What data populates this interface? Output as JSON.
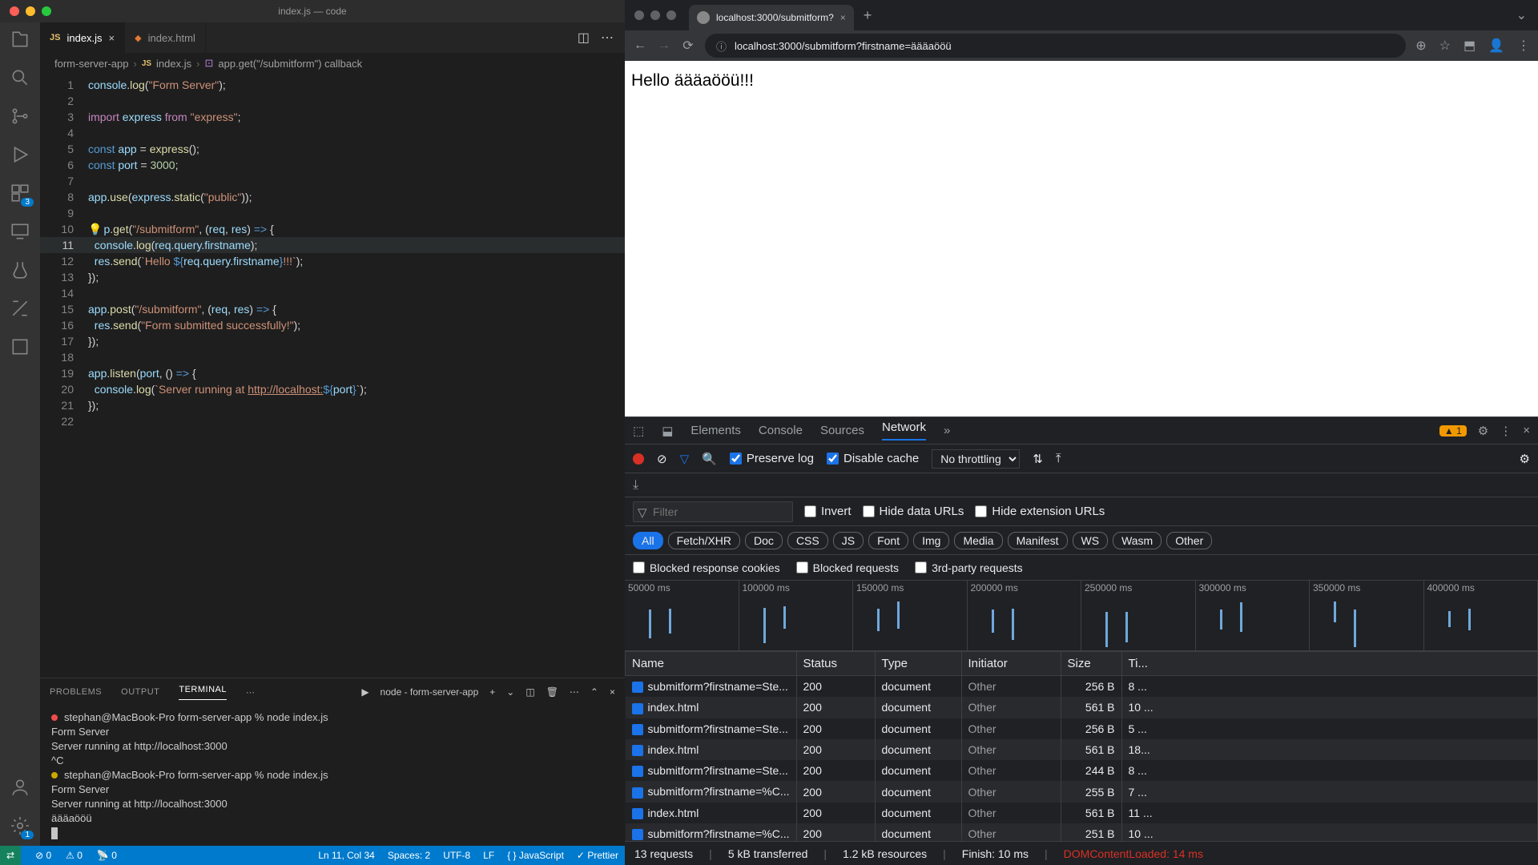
{
  "vscode": {
    "window_title": "index.js — code",
    "tabs": [
      {
        "icon": "JS",
        "label": "index.js",
        "active": true,
        "close": "×"
      },
      {
        "icon": "<>",
        "label": "index.html",
        "active": false
      }
    ],
    "breadcrumb": {
      "root": "form-server-app",
      "file": "index.js",
      "symbol": "app.get(\"/submitform\") callback"
    },
    "code_lines": [
      {
        "n": 1,
        "html": "<span class='var'>console</span>.<span class='fn'>log</span>(<span class='str'>\"Form Server\"</span>);"
      },
      {
        "n": 2,
        "html": ""
      },
      {
        "n": 3,
        "html": "<span class='kw'>import</span> <span class='var'>express</span> <span class='kw'>from</span> <span class='str'>\"express\"</span>;"
      },
      {
        "n": 4,
        "html": ""
      },
      {
        "n": 5,
        "html": "<span class='kw2'>const</span> <span class='var'>app</span> = <span class='fn'>express</span>();"
      },
      {
        "n": 6,
        "html": "<span class='kw2'>const</span> <span class='var'>port</span> = <span class='num'>3000</span>;"
      },
      {
        "n": 7,
        "html": ""
      },
      {
        "n": 8,
        "html": "<span class='var'>app</span>.<span class='fn'>use</span>(<span class='var'>express</span>.<span class='fn'>static</span>(<span class='str'>\"public\"</span>));"
      },
      {
        "n": 9,
        "html": ""
      },
      {
        "n": 10,
        "html": "<span class='bulb'>💡</span><span class='var'>p</span>.<span class='fn'>get</span>(<span class='str'>\"/submitform\"</span>, (<span class='var'>req</span>, <span class='var'>res</span>) <span class='kw2'>=&gt;</span> {"
      },
      {
        "n": 11,
        "html": "  <span class='var'>console</span>.<span class='fn'>log</span>(<span class='var'>req</span>.<span class='var'>query</span>.<span class='var'>firstname</span>);",
        "current": true
      },
      {
        "n": 12,
        "html": "  <span class='var'>res</span>.<span class='fn'>send</span>(<span class='str'>`Hello </span><span class='kw2'>${</span><span class='var'>req</span>.<span class='var'>query</span>.<span class='var'>firstname</span><span class='kw2'>}</span><span class='str'>!!!`</span>);"
      },
      {
        "n": 13,
        "html": "});"
      },
      {
        "n": 14,
        "html": ""
      },
      {
        "n": 15,
        "html": "<span class='var'>app</span>.<span class='fn'>post</span>(<span class='str'>\"/submitform\"</span>, (<span class='var'>req</span>, <span class='var'>res</span>) <span class='kw2'>=&gt;</span> {"
      },
      {
        "n": 16,
        "html": "  <span class='var'>res</span>.<span class='fn'>send</span>(<span class='str'>\"Form submitted successfully!\"</span>);"
      },
      {
        "n": 17,
        "html": "});"
      },
      {
        "n": 18,
        "html": ""
      },
      {
        "n": 19,
        "html": "<span class='var'>app</span>.<span class='fn'>listen</span>(<span class='var'>port</span>, () <span class='kw2'>=&gt;</span> {"
      },
      {
        "n": 20,
        "html": "  <span class='var'>console</span>.<span class='fn'>log</span>(<span class='str'>`Server running at <u>http://localhost:</u></span><span class='kw2'>${</span><span class='var'>port</span><span class='kw2'>}</span><span class='str'>`</span>);"
      },
      {
        "n": 21,
        "html": "});"
      },
      {
        "n": 22,
        "html": ""
      }
    ],
    "panel_tabs": {
      "problems": "PROBLEMS",
      "output": "OUTPUT",
      "terminal": "TERMINAL",
      "process": "node - form-server-app"
    },
    "terminal_lines": [
      {
        "dot": "red",
        "text": "stephan@MacBook-Pro form-server-app % node index.js"
      },
      {
        "text": "Form Server"
      },
      {
        "text": "Server running at http://localhost:3000"
      },
      {
        "text": "^C"
      },
      {
        "dot": "yellow",
        "text": "stephan@MacBook-Pro form-server-app % node index.js"
      },
      {
        "text": "Form Server"
      },
      {
        "text": "Server running at http://localhost:3000"
      },
      {
        "text": "äääaööü"
      }
    ],
    "statusbar": {
      "errors": "0",
      "warnings": "0",
      "radio": "0",
      "position": "Ln 11, Col 34",
      "spaces": "Spaces: 2",
      "encoding": "UTF-8",
      "eol": "LF",
      "lang": "JavaScript",
      "prettier": "Prettier"
    },
    "activity_badges": {
      "scm": "3",
      "settings": "1"
    }
  },
  "chrome": {
    "tab_title": "localhost:3000/submitform?",
    "url": "localhost:3000/submitform?firstname=äääaööü",
    "page_text": "Hello äääaööü!!!",
    "devtools": {
      "tabs": {
        "elements": "Elements",
        "console": "Console",
        "sources": "Sources",
        "network": "Network"
      },
      "warn_count": "1",
      "toolbar": {
        "preserve": "Preserve log",
        "disable_cache": "Disable cache",
        "throttling": "No throttling"
      },
      "filter_placeholder": "Filter",
      "filter_checks": {
        "invert": "Invert",
        "hide_urls": "Hide data URLs",
        "hide_ext": "Hide extension URLs"
      },
      "chips": [
        "All",
        "Fetch/XHR",
        "Doc",
        "CSS",
        "JS",
        "Font",
        "Img",
        "Media",
        "Manifest",
        "WS",
        "Wasm",
        "Other"
      ],
      "checks2": {
        "brc": "Blocked response cookies",
        "br": "Blocked requests",
        "tpr": "3rd-party requests"
      },
      "timeline_ticks": [
        "50000 ms",
        "100000 ms",
        "150000 ms",
        "200000 ms",
        "250000 ms",
        "300000 ms",
        "350000 ms",
        "400000 ms"
      ],
      "columns": {
        "name": "Name",
        "status": "Status",
        "type": "Type",
        "initiator": "Initiator",
        "size": "Size",
        "time": "Ti..."
      },
      "rows": [
        {
          "name": "submitform?firstname=Ste...",
          "status": "200",
          "type": "document",
          "initiator": "Other",
          "size": "256 B",
          "time": "8 ..."
        },
        {
          "name": "index.html",
          "status": "200",
          "type": "document",
          "initiator": "Other",
          "size": "561 B",
          "time": "10 ..."
        },
        {
          "name": "submitform?firstname=Ste...",
          "status": "200",
          "type": "document",
          "initiator": "Other",
          "size": "256 B",
          "time": "5 ..."
        },
        {
          "name": "index.html",
          "status": "200",
          "type": "document",
          "initiator": "Other",
          "size": "561 B",
          "time": "18..."
        },
        {
          "name": "submitform?firstname=Ste...",
          "status": "200",
          "type": "document",
          "initiator": "Other",
          "size": "244 B",
          "time": "8 ..."
        },
        {
          "name": "submitform?firstname=%C...",
          "status": "200",
          "type": "document",
          "initiator": "Other",
          "size": "255 B",
          "time": "7 ..."
        },
        {
          "name": "index.html",
          "status": "200",
          "type": "document",
          "initiator": "Other",
          "size": "561 B",
          "time": "11 ..."
        },
        {
          "name": "submitform?firstname=%C...",
          "status": "200",
          "type": "document",
          "initiator": "Other",
          "size": "251 B",
          "time": "10 ..."
        }
      ],
      "status": {
        "requests": "13 requests",
        "transferred": "5 kB transferred",
        "resources": "1.2 kB resources",
        "finish": "Finish: 10 ms",
        "dcl": "DOMContentLoaded: 14 ms"
      }
    }
  }
}
